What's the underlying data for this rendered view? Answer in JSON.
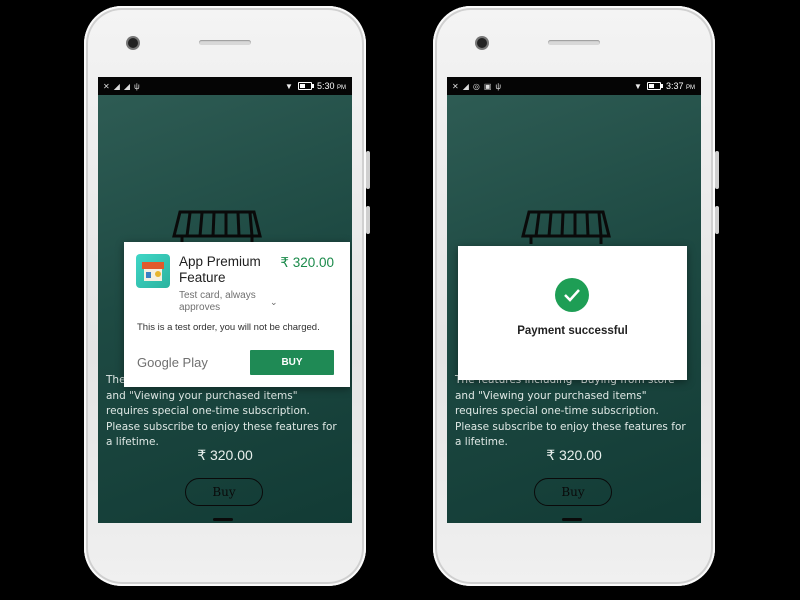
{
  "left": {
    "status": {
      "time": "5:30",
      "ampm": "PM",
      "left_icons": [
        "close-icon",
        "signal-icon",
        "signal-icon",
        "usb-icon"
      ],
      "battery": 0.5
    },
    "description": "The features including \"Buying from store\" and \"Viewing your purchased items\" requires special one-time subscription. Please subscribe to enjoy these features for a lifetime.",
    "price": "₹ 320.00",
    "buy_label": "Buy",
    "dialog": {
      "title": "App Premium Feature",
      "price": "₹ 320.00",
      "payment_method": "Test card, always approves",
      "test_note": "This is a test order, you will not be charged.",
      "provider": "Google Play",
      "buy_button": "BUY"
    }
  },
  "right": {
    "status": {
      "time": "3:37",
      "ampm": "PM",
      "left_icons": [
        "close-icon",
        "signal-icon",
        "whatsapp-icon",
        "image-icon",
        "usb-icon"
      ],
      "battery": 0.5
    },
    "description": "The features including \"Buying from store\" and \"Viewing your purchased items\" requires special one-time subscription. Please subscribe to enjoy these features for a lifetime.",
    "price": "₹ 320.00",
    "buy_label": "Buy",
    "success_text": "Payment successful"
  },
  "colors": {
    "accent_green": "#1f8a55",
    "price_green": "#1a8a4a",
    "screen_bg": "#1e4a43"
  }
}
